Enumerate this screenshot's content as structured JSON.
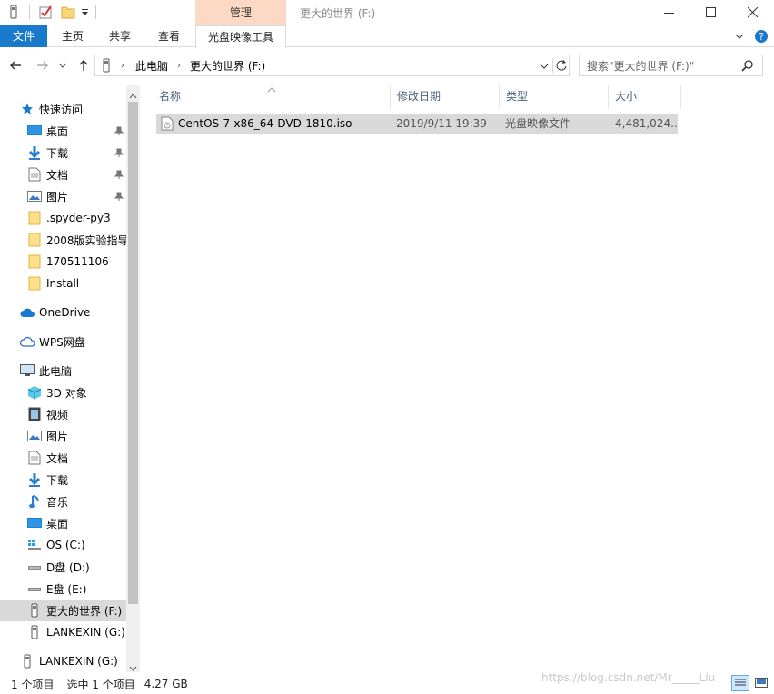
{
  "titlebar": {
    "manage_tab": "管理",
    "window_title": "更大的世界 (F:)"
  },
  "ribbon": {
    "tabs": [
      {
        "label": "文件"
      },
      {
        "label": "主页"
      },
      {
        "label": "共享"
      },
      {
        "label": "查看"
      },
      {
        "label": "光盘映像工具"
      }
    ]
  },
  "address": {
    "crumbs": [
      "此电脑",
      "更大的世界 (F:)"
    ],
    "search_placeholder": "搜索\"更大的世界 (F:)\""
  },
  "nav": {
    "quick_access": "快速访问",
    "quick_items": [
      {
        "label": "桌面",
        "icon": "desktop-icon"
      },
      {
        "label": "下载",
        "icon": "download-icon"
      },
      {
        "label": "文档",
        "icon": "document-icon"
      },
      {
        "label": "图片",
        "icon": "picture-icon"
      },
      {
        "label": ".spyder-py3",
        "icon": "folder-icon"
      },
      {
        "label": "2008版实验指导",
        "icon": "folder-icon"
      },
      {
        "label": "170511106",
        "icon": "folder-icon"
      },
      {
        "label": "Install",
        "icon": "folder-icon"
      }
    ],
    "onedrive": "OneDrive",
    "wps": "WPS网盘",
    "this_pc": "此电脑",
    "pc_items": [
      {
        "label": "3D 对象",
        "icon": "3d-objects-icon"
      },
      {
        "label": "视频",
        "icon": "video-icon"
      },
      {
        "label": "图片",
        "icon": "picture-icon"
      },
      {
        "label": "文档",
        "icon": "document-icon"
      },
      {
        "label": "下载",
        "icon": "download-icon"
      },
      {
        "label": "音乐",
        "icon": "music-icon"
      },
      {
        "label": "桌面",
        "icon": "desktop-icon"
      },
      {
        "label": "OS (C:)",
        "icon": "windows-drive-icon"
      },
      {
        "label": "D盘 (D:)",
        "icon": "drive-icon"
      },
      {
        "label": "E盘 (E:)",
        "icon": "drive-icon"
      },
      {
        "label": "更大的世界 (F:)",
        "icon": "usb-drive-icon"
      },
      {
        "label": "LANKEXIN (G:)",
        "icon": "usb-drive-icon"
      }
    ],
    "bottom_item": "LANKEXIN (G:)"
  },
  "columns": {
    "name": "名称",
    "modified": "修改日期",
    "type": "类型",
    "size": "大小"
  },
  "files": [
    {
      "name": "CentOS-7-x86_64-DVD-1810.iso",
      "modified": "2019/9/11 19:39",
      "type": "光盘映像文件",
      "size": "4,481,024..."
    }
  ],
  "status": {
    "count": "1 个项目",
    "selected": "选中 1 个项目",
    "size": "4.27 GB"
  },
  "watermark": "https://blog.csdn.net/Mr_____Liu",
  "colors": {
    "accent": "#1979ca",
    "manage_tab": "#fbd9c4",
    "selection": "#cce8ff"
  }
}
